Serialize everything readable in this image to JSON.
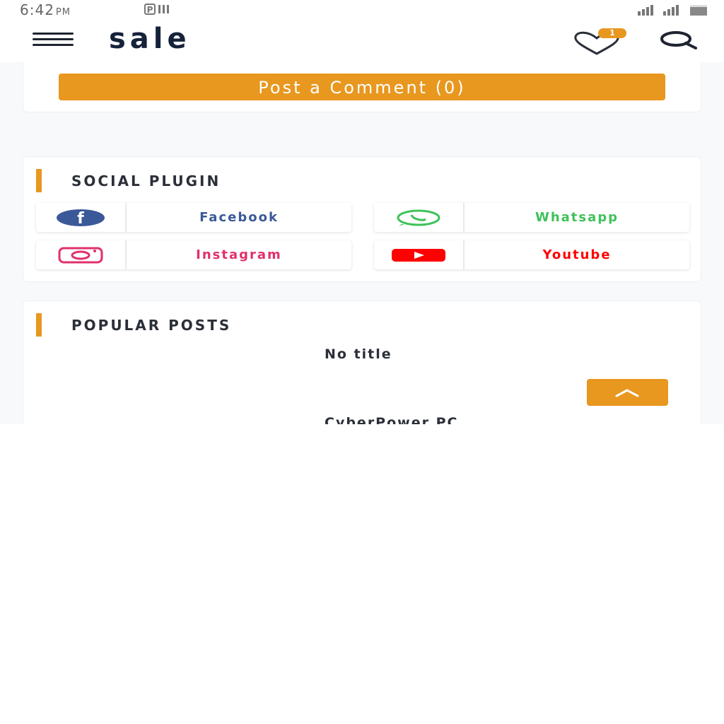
{
  "status_bar": {
    "time": "6:42",
    "ampm": "PM"
  },
  "header": {
    "site_title": "sale",
    "wishlist_count": "1"
  },
  "comments": {
    "post_comment_label": "Post a Comment (0)"
  },
  "social_plugin": {
    "title": "SOCIAL PLUGIN",
    "items": [
      {
        "label": "Facebook",
        "icon": "facebook-icon",
        "color": "#3b5998"
      },
      {
        "label": "Whatsapp",
        "icon": "whatsapp-icon",
        "color": "#3fc25a"
      },
      {
        "label": "Instagram",
        "icon": "instagram-icon",
        "color": "#e1306c"
      },
      {
        "label": "Youtube",
        "icon": "youtube-icon",
        "color": "#ff0000"
      }
    ]
  },
  "popular_posts": {
    "title": "POPULAR POSTS",
    "posts": [
      {
        "title": "No title"
      },
      {
        "title": "CyberPower PC"
      }
    ]
  },
  "colors": {
    "accent": "#e8971f",
    "brand_dark": "#14223a"
  }
}
